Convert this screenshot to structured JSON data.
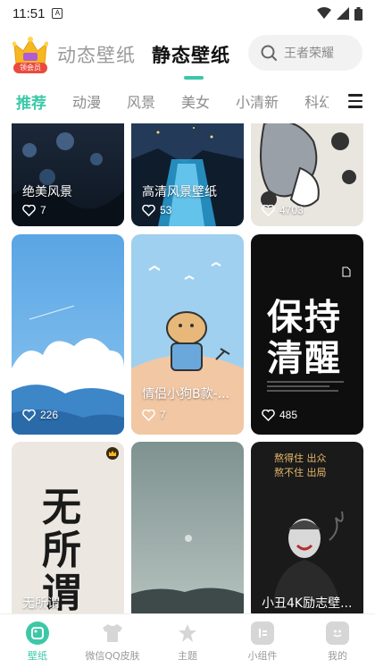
{
  "status": {
    "time": "11:51",
    "badge": "A"
  },
  "header": {
    "vip_label": "领会员",
    "tabs": [
      "动态壁纸",
      "静态壁纸"
    ],
    "search_placeholder": "王者荣耀"
  },
  "categories": [
    "推荐",
    "动漫",
    "风景",
    "美女",
    "小清新",
    "科幻"
  ],
  "cards": [
    {
      "caption": "绝美风景",
      "likes": "7"
    },
    {
      "caption": "高清风景壁纸",
      "likes": "53"
    },
    {
      "caption": "",
      "likes": "4703"
    },
    {
      "caption": "",
      "likes": "226"
    },
    {
      "caption": "情侣小狗B款-...",
      "likes": "7"
    },
    {
      "caption": "",
      "likes": "485",
      "poster_text": [
        "保持",
        "清醒"
      ]
    },
    {
      "caption": "无所谓",
      "likes": "",
      "poster_text": [
        "无所谓"
      ]
    },
    {
      "caption": "",
      "likes": ""
    },
    {
      "caption": "小丑4K励志壁...",
      "likes": "",
      "poster_text": [
        "熬得住 出众",
        "熬不住 出局"
      ]
    }
  ],
  "bottom_nav": [
    "壁纸",
    "微信QQ皮肤",
    "主题",
    "小组件",
    "我的"
  ],
  "colors": {
    "accent": "#3cc8a8",
    "badge_red": "#e94b3c"
  }
}
